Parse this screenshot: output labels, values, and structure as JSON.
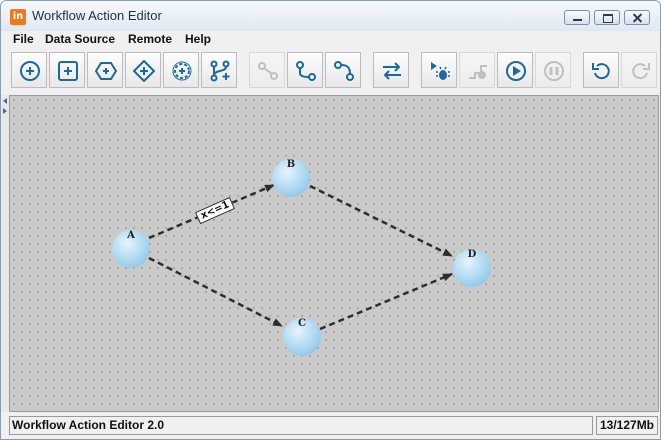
{
  "window": {
    "title": "Workflow Action Editor",
    "app_icon_text": "in"
  },
  "menu": [
    "File",
    "Data Source",
    "Remote",
    "Help"
  ],
  "toolbar": [
    {
      "name": "add-circle-node",
      "icon": "circle-plus-icon",
      "enabled": true
    },
    {
      "name": "add-square-node",
      "icon": "square-plus-icon",
      "enabled": true
    },
    {
      "name": "add-hexagon-node",
      "icon": "hexagon-plus-icon",
      "enabled": true
    },
    {
      "name": "add-diamond-node",
      "icon": "diamond-plus-icon",
      "enabled": true
    },
    {
      "name": "add-gear-node",
      "icon": "gear-plus-icon",
      "enabled": true
    },
    {
      "name": "add-fork-node",
      "icon": "fork-plus-icon",
      "enabled": true
    },
    {
      "name": "connect",
      "icon": "link-icon",
      "enabled": false
    },
    {
      "name": "connect-right",
      "icon": "connect-right-icon",
      "enabled": true
    },
    {
      "name": "connect-left",
      "icon": "connect-left-icon",
      "enabled": true
    },
    {
      "name": "swap",
      "icon": "swap-arrows-icon",
      "enabled": true
    },
    {
      "name": "debug",
      "icon": "debug-bug-icon",
      "enabled": true
    },
    {
      "name": "step",
      "icon": "step-icon",
      "enabled": false
    },
    {
      "name": "play",
      "icon": "play-icon",
      "enabled": true
    },
    {
      "name": "pause",
      "icon": "pause-icon",
      "enabled": false
    },
    {
      "name": "undo",
      "icon": "undo-icon",
      "enabled": true
    },
    {
      "name": "redo",
      "icon": "redo-icon",
      "enabled": false
    }
  ],
  "graph": {
    "nodes": [
      {
        "id": "A",
        "label": "A"
      },
      {
        "id": "B",
        "label": "B"
      },
      {
        "id": "C",
        "label": "C"
      },
      {
        "id": "D",
        "label": "D"
      }
    ],
    "edges": [
      {
        "from": "A",
        "to": "B",
        "label": "x<=1"
      },
      {
        "from": "B",
        "to": "D",
        "label": ""
      },
      {
        "from": "A",
        "to": "C",
        "label": ""
      },
      {
        "from": "C",
        "to": "D",
        "label": ""
      }
    ]
  },
  "status": {
    "left": "Workflow Action Editor 2.0",
    "memory": "13/127Mb"
  },
  "colors": {
    "accent": "#1a6a9e",
    "node": "#a9d6f0",
    "canvas": "#cacaca"
  }
}
